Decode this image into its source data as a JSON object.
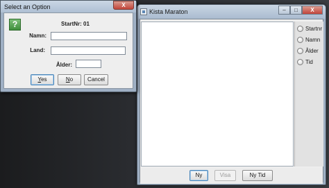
{
  "main_window": {
    "title": "Kista Maraton",
    "controls": {
      "minimize": "–",
      "maximize": "□",
      "close": "X"
    },
    "radio_options": [
      "Startnr",
      "Namn",
      "Ålder",
      "Tid"
    ],
    "buttons": {
      "new_label": "Ny",
      "show_label": "Visa",
      "new_time_label": "Ny Tid"
    }
  },
  "dialog": {
    "title": "Select an Option",
    "close": "X",
    "icon_glyph": "?",
    "startnr_label": "StartNr: 01",
    "name_label": "Namn:",
    "name_value": "",
    "country_label": "Land:",
    "country_value": "",
    "age_label": "Ålder:",
    "age_value": "",
    "buttons": {
      "yes_underlined": "Y",
      "yes_rest": "es",
      "no_underlined": "N",
      "no_rest": "o",
      "cancel_label": "Cancel"
    }
  },
  "colors": {
    "titlebar": "#aebfd3",
    "close_button": "#c2453a",
    "focus_border": "#4b86b9",
    "question_icon": "#3f8f3c"
  }
}
